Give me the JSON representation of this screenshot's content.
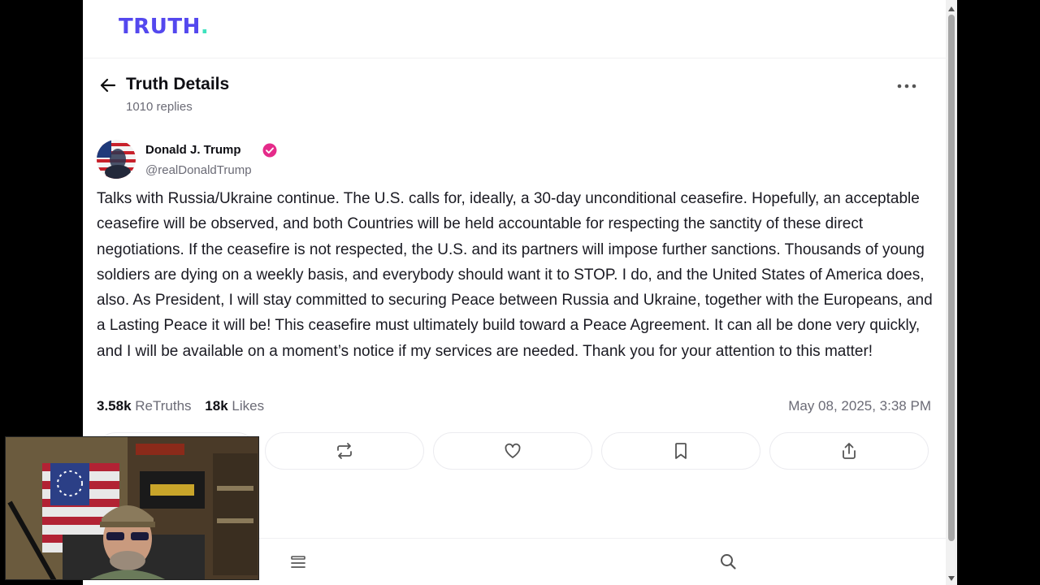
{
  "brand": {
    "name": "TRUTH",
    "dot": "."
  },
  "header": {
    "title": "Truth Details",
    "replies": "1010 replies"
  },
  "post": {
    "author_name": "Donald J. Trump",
    "author_handle": "@realDonaldTrump",
    "body": "Talks with Russia/Ukraine continue. The U.S. calls for, ideally, a 30-day unconditional ceasefire. Hopefully, an acceptable ceasefire will be observed, and both Countries will be held accountable for respecting the sanctity of these direct negotiations. If the ceasefire is not respected, the U.S. and its partners will impose further sanctions. Thousands of young soldiers are dying on a weekly basis, and everybody should want it to STOP. I do, and the United States of America does, also. As President, I will stay committed to securing Peace between Russia and Ukraine, together with the Europeans, and a Lasting Peace it will be! This ceasefire must ultimately build toward a Peace Agreement. It can all be done very quickly, and I will be available on a moment’s notice if my services are needed. Thank you for your attention to this matter!",
    "retruths_count": "3.58k",
    "retruths_label": "ReTruths",
    "likes_count": "18k",
    "likes_label": "Likes",
    "timestamp": "May 08, 2025, 3:38 PM"
  },
  "icons": {
    "back": "arrow-left-icon",
    "more": "more-horizontal-icon",
    "verified": "verified-badge-icon",
    "actions": [
      "reply-icon",
      "retruth-icon",
      "heart-icon",
      "bookmark-icon",
      "share-icon"
    ],
    "bottom_nav": [
      "menu-icon",
      "search-icon"
    ]
  },
  "colors": {
    "brand": "#5448ee",
    "brand_dot": "#3ee2bd",
    "verified": "#e52b8a",
    "text": "#1a1a22",
    "muted": "#6b6b76"
  }
}
